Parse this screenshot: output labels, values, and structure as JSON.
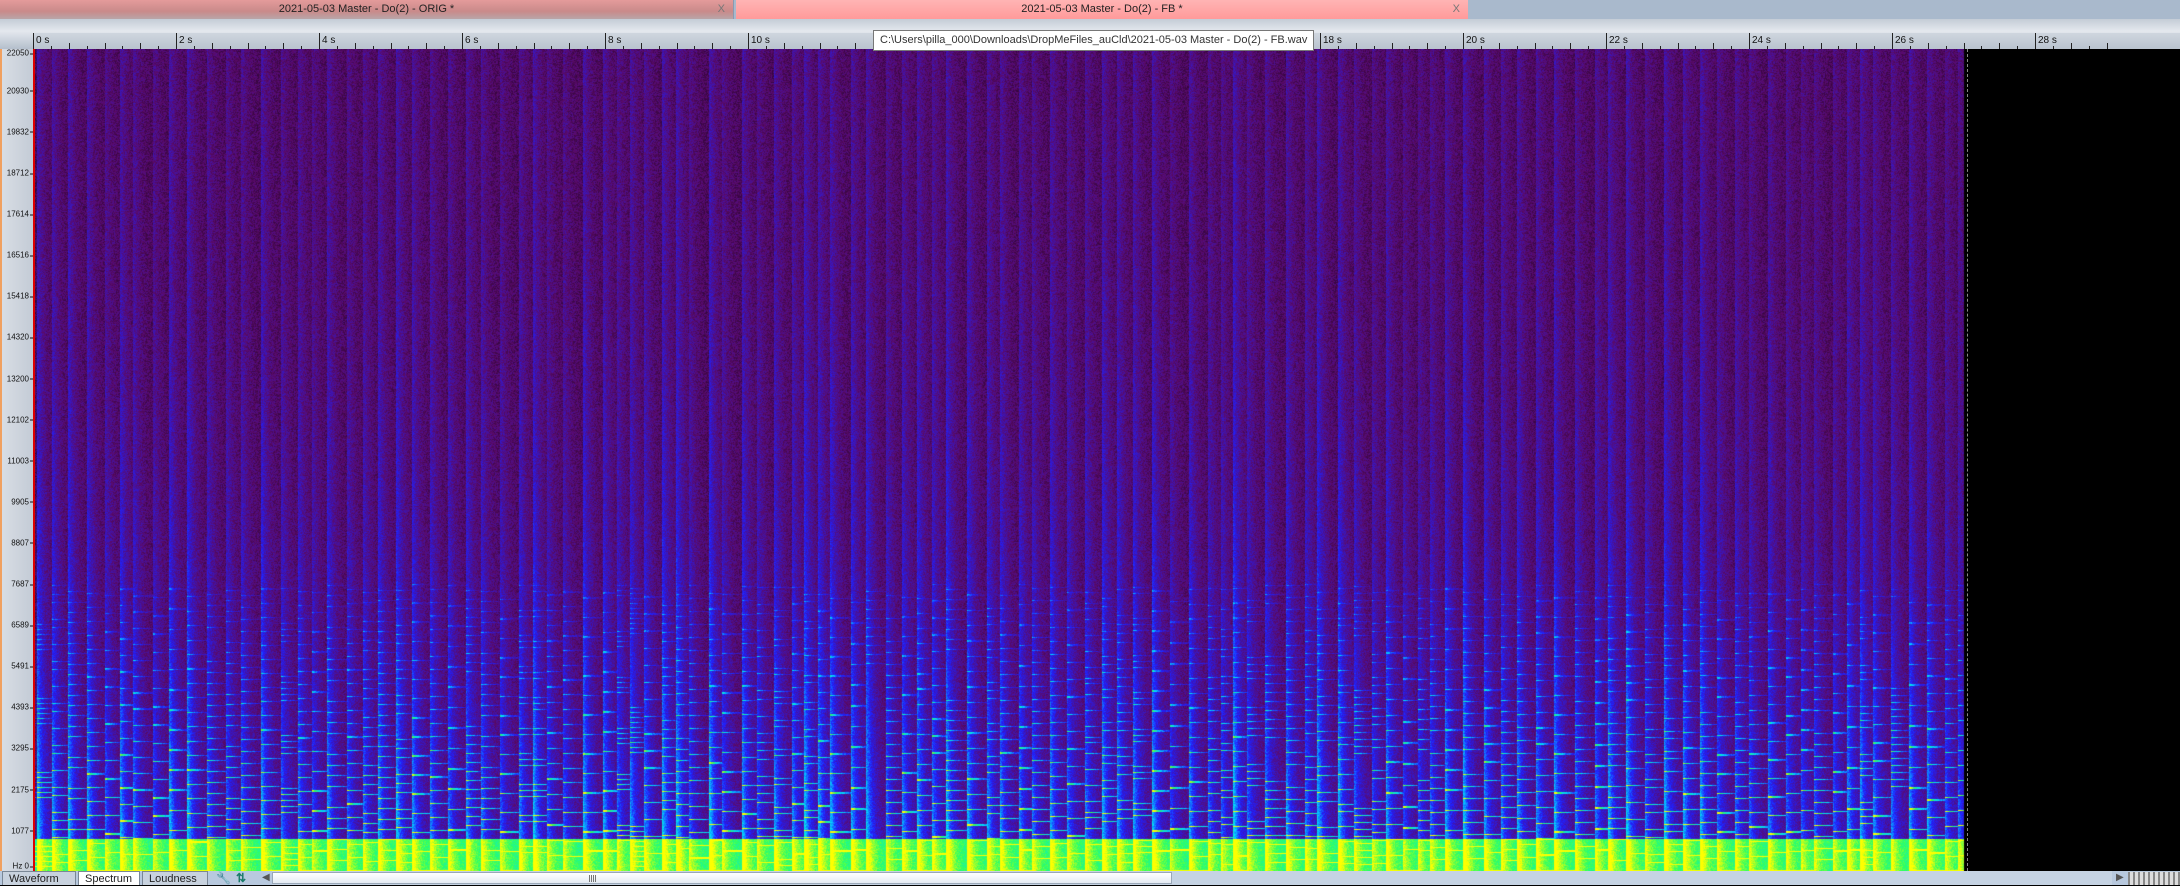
{
  "tabs": [
    {
      "label": "2021-05-03 Master - Do(2) - ORIG *",
      "close": "X",
      "active": false
    },
    {
      "label": "2021-05-03 Master - Do(2) - FB *",
      "close": "X",
      "active": true
    }
  ],
  "tooltip": "C:\\Users\\pilla_000\\Downloads\\DropMeFiles_auCld\\2021-05-03 Master - Do(2) - FB.wav",
  "time_axis": {
    "unit": "s",
    "labels": [
      "0 s",
      "2 s",
      "4 s",
      "6 s",
      "8 s",
      "10 s",
      "12 s",
      "14 s",
      "16 s",
      "18 s",
      "20 s",
      "22 s",
      "24 s",
      "26 s",
      "28 s"
    ],
    "max_seconds": 28,
    "audio_length_seconds": 27
  },
  "freq_axis": {
    "unit": "Hz",
    "labels": [
      "22050",
      "20930",
      "19832",
      "18712",
      "17614",
      "16516",
      "15418",
      "14320",
      "13200",
      "12102",
      "11003",
      "9905",
      "8807",
      "7687",
      "6589",
      "5491",
      "4393",
      "3295",
      "2175",
      "1077",
      "0"
    ]
  },
  "bottom_tabs": [
    {
      "label": "Waveform",
      "active": false
    },
    {
      "label": "Spectrum",
      "active": true
    },
    {
      "label": "Loudness",
      "active": false
    }
  ],
  "icons": {
    "settings": "wrench-icon",
    "channels": "up-down-arrows-icon"
  },
  "colors": {
    "cursor": "#dd0000",
    "active_tab": "#ff9a9a",
    "colormap": [
      "#000000",
      "#5a0a6a",
      "#2020ff",
      "#00e0ff",
      "#30ff60",
      "#ffff00"
    ]
  }
}
